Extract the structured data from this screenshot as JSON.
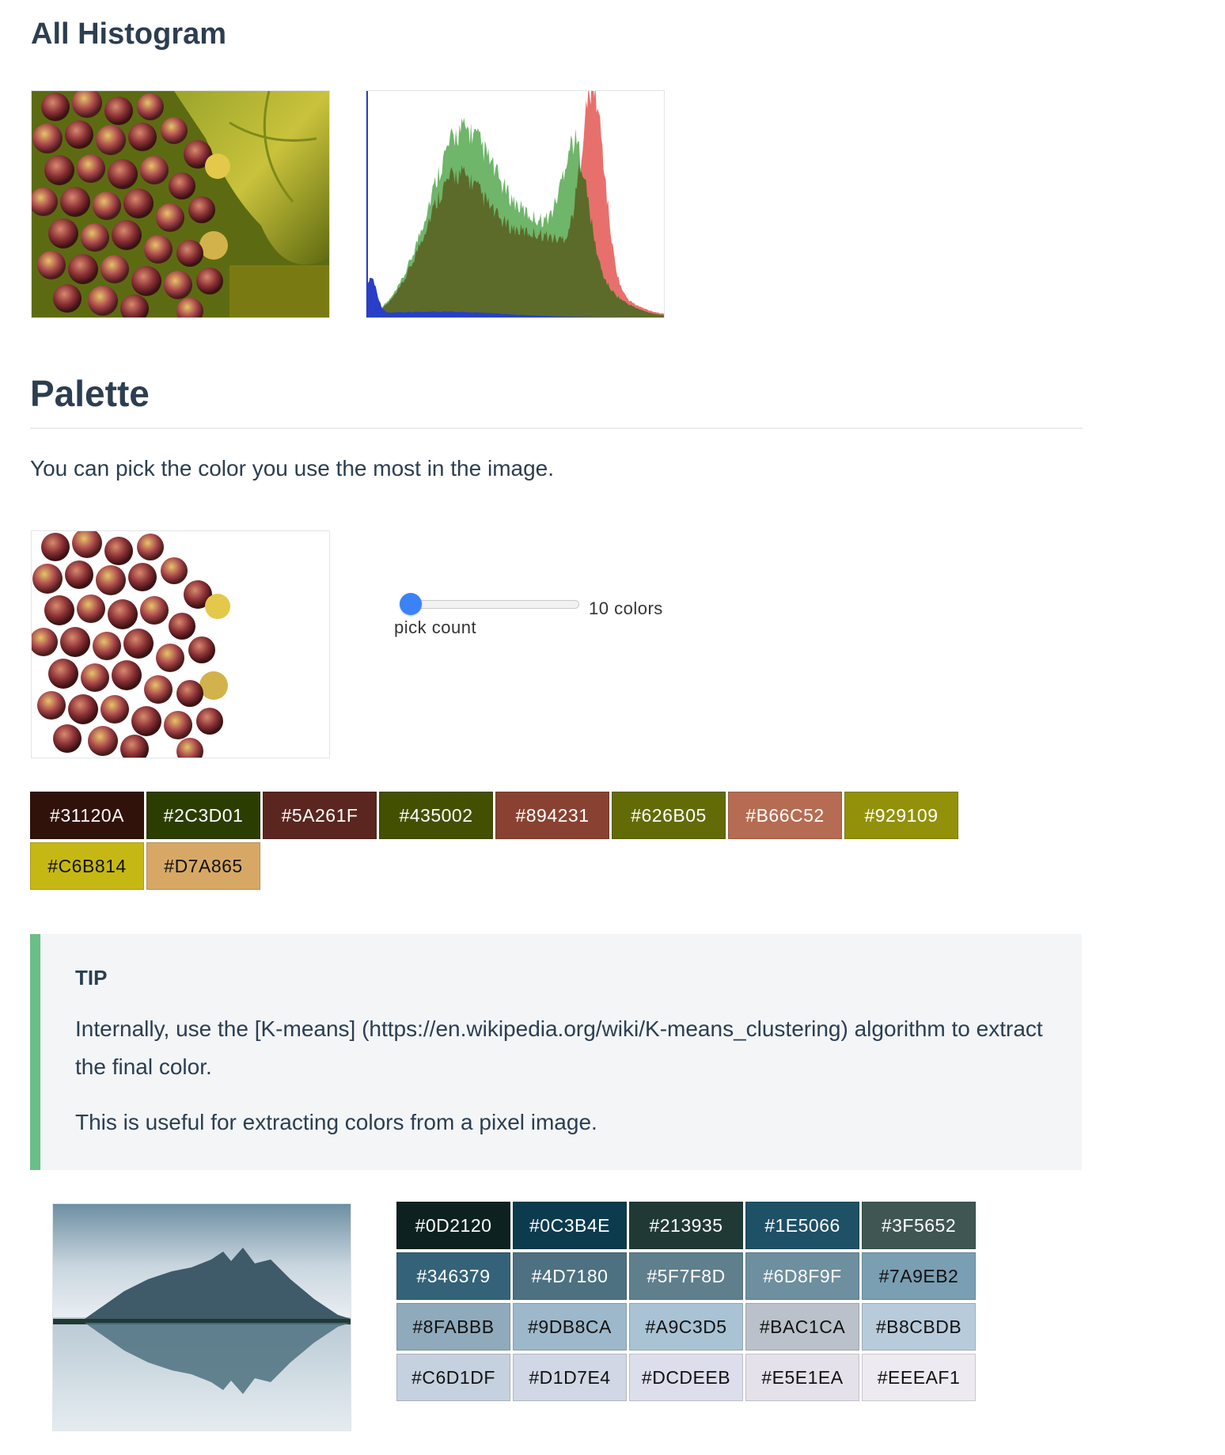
{
  "histogram_section": {
    "title": "All Histogram",
    "image_alt": "grapes image",
    "chart_alt": "RGB histogram"
  },
  "palette_section": {
    "title": "Palette",
    "description": "You can pick the color you use the most in the image.",
    "slider": {
      "label": "pick count",
      "value_text": "10 colors",
      "value": 10,
      "min": 1,
      "max": 100
    },
    "swatches": [
      "#31120A",
      "#2C3D01",
      "#5A261F",
      "#435002",
      "#894231",
      "#626B05",
      "#B66C52",
      "#929109",
      "#C6B814",
      "#D7A865"
    ]
  },
  "tip": {
    "title": "TIP",
    "paragraph1": "Internally, use the [K-means] (https://en.wikipedia.org/wiki/K-means_clustering) algorithm to extract the final color.",
    "paragraph2": "This is useful for extracting colors from a pixel image."
  },
  "example": {
    "image_alt": "mountain lake image",
    "swatches": [
      "#0D2120",
      "#0C3B4E",
      "#213935",
      "#1E5066",
      "#3F5652",
      "#346379",
      "#4D7180",
      "#5F7F8D",
      "#6D8F9F",
      "#7A9EB2",
      "#8FABBB",
      "#9DB8CA",
      "#A9C3D5",
      "#BAC1CA",
      "#B8CBDB",
      "#C6D1DF",
      "#D1D7E4",
      "#DCDEEB",
      "#E5E1EA",
      "#EEEAF1"
    ]
  }
}
